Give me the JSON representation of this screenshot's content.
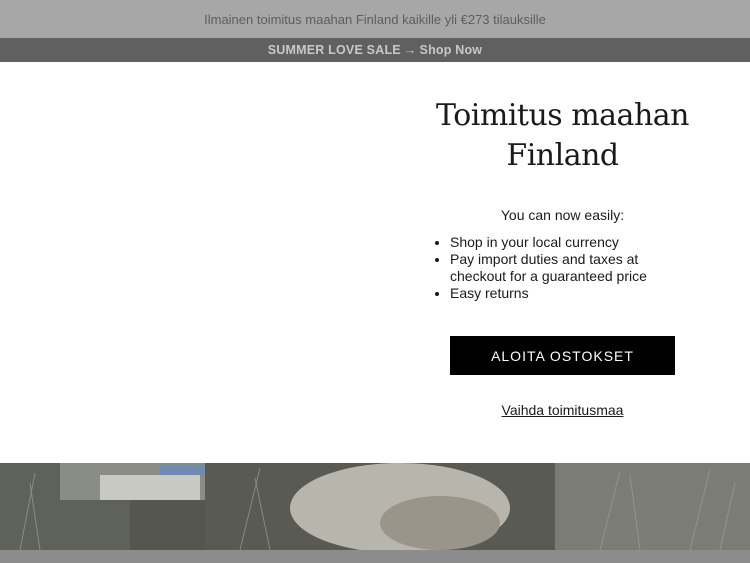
{
  "announcement": {
    "shipping_text": "Ilmainen toimitus maahan Finland kaikille yli €273 tilauksille"
  },
  "promo": {
    "sale_label": "SUMMER LOVE SALE",
    "arrow": "→",
    "shop_now_label": "Shop Now"
  },
  "modal": {
    "title_line1": "Toimitus maahan",
    "title_line2": "Finland",
    "lead": "You can now easily:",
    "benefits": [
      "Shop in your local currency",
      "Pay import duties and taxes at checkout for a guaranteed price",
      "Easy returns"
    ],
    "cta_label": "ALOITA OSTOKSET",
    "change_country_label": "Vaihda toimitusmaa"
  }
}
